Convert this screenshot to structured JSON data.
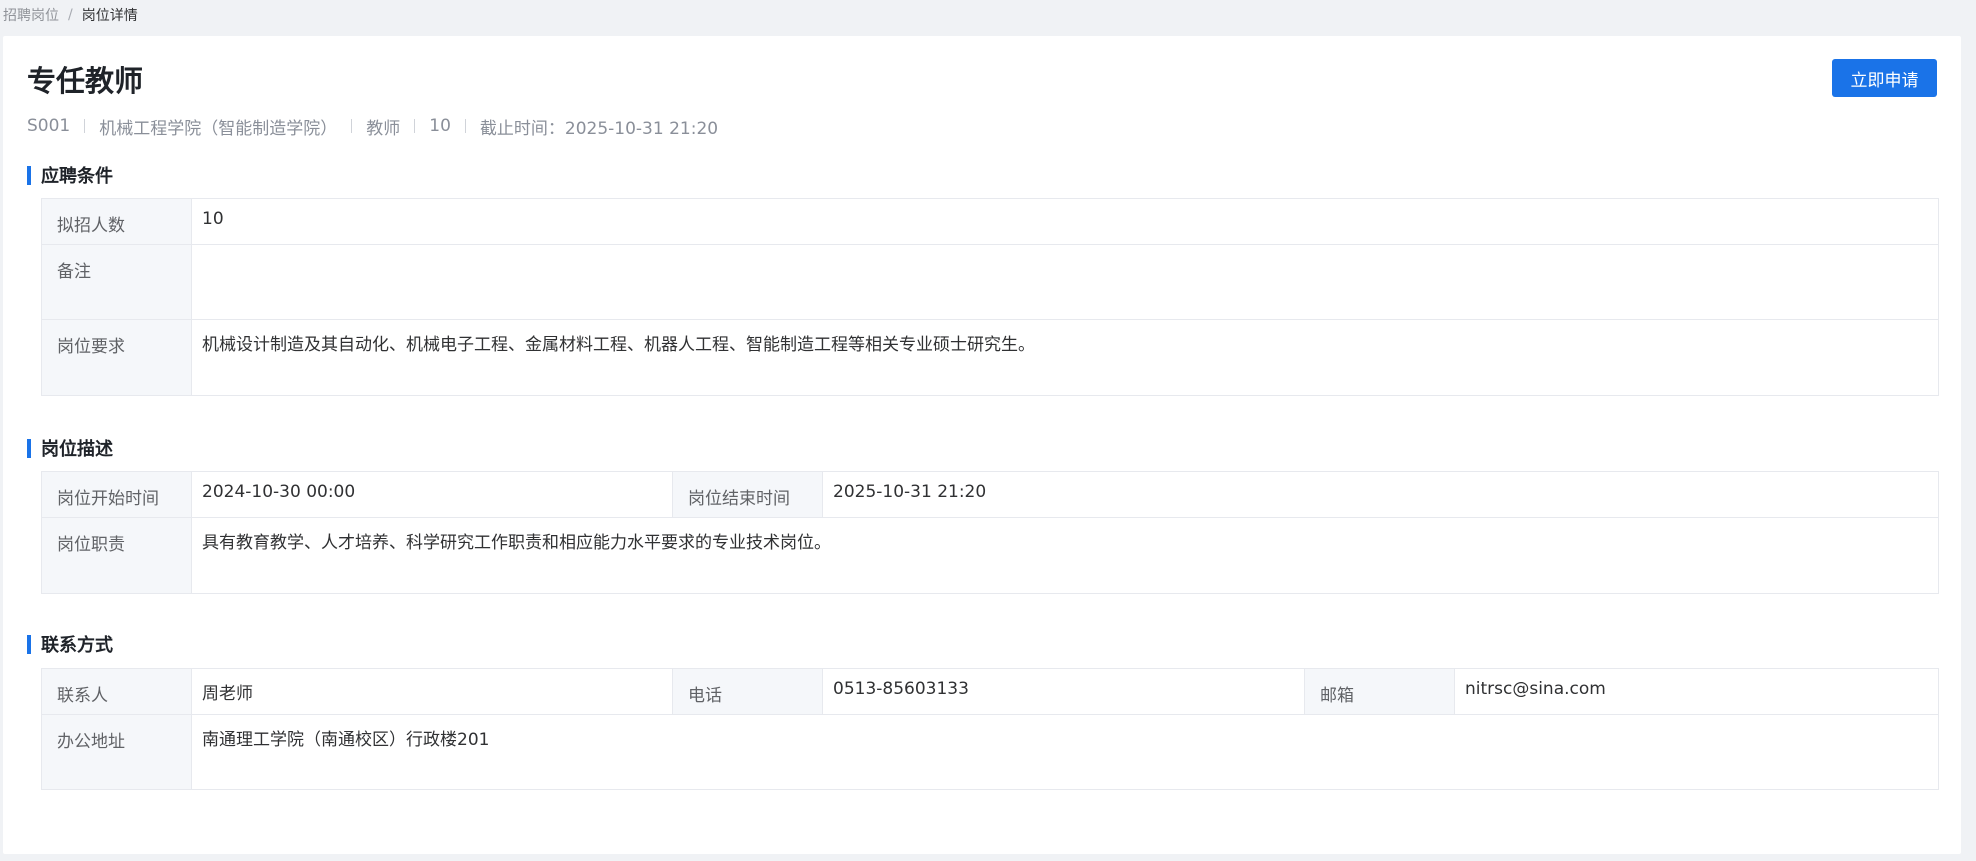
{
  "breadcrumb": {
    "parent": "招聘岗位",
    "separator": "/",
    "current": "岗位详情"
  },
  "header": {
    "title": "专任教师",
    "apply_label": "立即申请",
    "meta": {
      "code": "S001",
      "department": "机械工程学院（智能制造学院）",
      "category": "教师",
      "count": "10",
      "deadline": "截止时间：2025-10-31 21:20"
    }
  },
  "requirements": {
    "title": "应聘条件",
    "headcount_label": "拟招人数",
    "headcount_value": "10",
    "remark_label": "备注",
    "remark_value": "",
    "requirement_label": "岗位要求",
    "requirement_value": "机械设计制造及其自动化、机械电子工程、金属材料工程、机器人工程、智能制造工程等相关专业硕士研究生。"
  },
  "description": {
    "title": "岗位描述",
    "start_label": "岗位开始时间",
    "start_value": "2024-10-30 00:00",
    "end_label": "岗位结束时间",
    "end_value": "2025-10-31 21:20",
    "duty_label": "岗位职责",
    "duty_value": "具有教育教学、人才培养、科学研究工作职责和相应能力水平要求的专业技术岗位。"
  },
  "contact": {
    "title": "联系方式",
    "person_label": "联系人",
    "person_value": "周老师",
    "phone_label": "电话",
    "phone_value": "0513-85603133",
    "email_label": "邮箱",
    "email_value": "nitrsc@sina.com",
    "address_label": "办公地址",
    "address_value": "南通理工学院（南通校区）行政楼201"
  },
  "colors": {
    "accent": "#1a73e8",
    "label_bg": "#f5f7fa",
    "border": "#e7e9ee"
  }
}
